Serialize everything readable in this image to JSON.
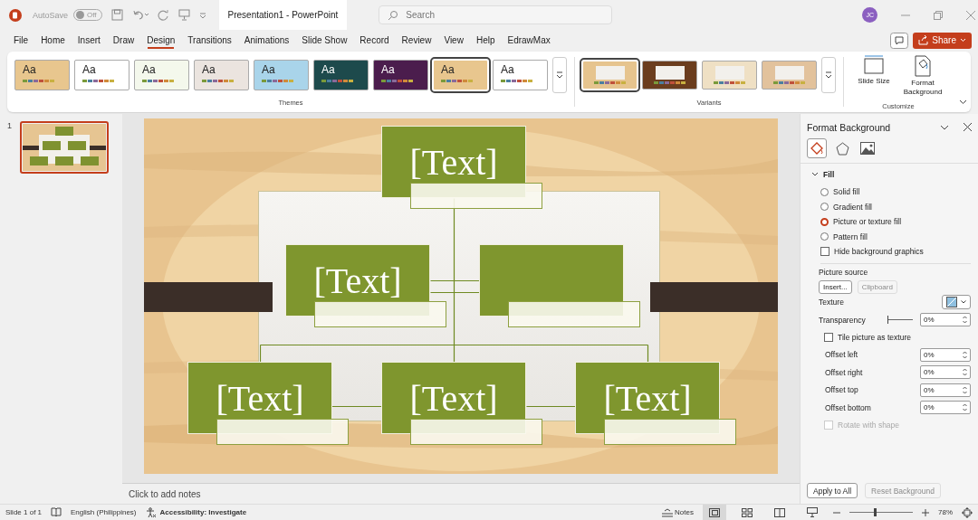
{
  "title_bar": {
    "autosave_label": "AutoSave",
    "autosave": {
      "on": false,
      "label": "Off"
    },
    "title": "Presentation1  -  PowerPoint",
    "search": {
      "placeholder": "Search"
    },
    "avatar": "JC"
  },
  "menu": {
    "tabs": [
      {
        "label": "File",
        "selected": false
      },
      {
        "label": "Home",
        "selected": false
      },
      {
        "label": "Insert",
        "selected": false
      },
      {
        "label": "Draw",
        "selected": false
      },
      {
        "label": "Design",
        "selected": true
      },
      {
        "label": "Transitions",
        "selected": false
      },
      {
        "label": "Animations",
        "selected": false
      },
      {
        "label": "Slide Show",
        "selected": false
      },
      {
        "label": "Record",
        "selected": false
      },
      {
        "label": "Review",
        "selected": false
      },
      {
        "label": "View",
        "selected": false
      },
      {
        "label": "Help",
        "selected": false
      },
      {
        "label": "EdrawMax",
        "selected": false
      }
    ],
    "share": "Share"
  },
  "ribbon": {
    "themes": [
      {
        "label": "Aa",
        "color": "#e8c68e",
        "selected": false
      },
      {
        "label": "Aa",
        "color": "#ffffff",
        "selected": false
      },
      {
        "label": "Aa",
        "color": "#f4f8ec",
        "selected": false
      },
      {
        "label": "Aa",
        "color": "#ebe4df",
        "selected": false
      },
      {
        "label": "Aa",
        "color": "#a9d4ea",
        "selected": false
      },
      {
        "label": "Aa",
        "color": "#1d4a4c",
        "selected": false
      },
      {
        "label": "Aa",
        "color": "#4b1d4d",
        "selected": false
      },
      {
        "label": "Aa",
        "color": "#e8c68e",
        "selected": true
      },
      {
        "label": "Aa",
        "color": "#ffffff",
        "selected": false
      }
    ],
    "themes_label": "Themes",
    "variants": [
      {
        "color": "#e6c48e",
        "selected": true
      },
      {
        "color": "#6b3d1e",
        "selected": false
      },
      {
        "color": "#efe0c4",
        "selected": false
      },
      {
        "color": "#e2c29c",
        "selected": false
      }
    ],
    "variants_label": "Variants",
    "customize": [
      {
        "label": "Slide Size",
        "kind": "size"
      },
      {
        "label": "Format Background",
        "kind": "background"
      }
    ],
    "customize_label": "Customize"
  },
  "thumbnails": [
    {
      "number": "1",
      "selected": true
    }
  ],
  "slide": {
    "nodes": [
      {
        "kind": "text",
        "text": "[Text]"
      },
      {
        "kind": "text",
        "text": "[Text]"
      },
      {
        "kind": "blank"
      },
      {
        "kind": "text",
        "text": "[Text]"
      },
      {
        "kind": "text",
        "text": "[Text]"
      },
      {
        "kind": "text",
        "text": "[Text]"
      }
    ]
  },
  "notes": {
    "placeholder": "Click to add notes"
  },
  "panel": {
    "title": "Format Background",
    "tabs": [
      {
        "kind": "fill",
        "selected": true
      },
      {
        "kind": "effects",
        "selected": false
      },
      {
        "kind": "picture",
        "selected": false
      }
    ],
    "section": {
      "label": "Fill",
      "expanded": true
    },
    "fill_options": [
      {
        "label": "Solid fill",
        "selected": false
      },
      {
        "label": "Gradient fill",
        "selected": false
      },
      {
        "label": "Picture or texture fill",
        "selected": true
      },
      {
        "label": "Pattern fill",
        "selected": false
      }
    ],
    "hide_graphics": {
      "label": "Hide background graphics",
      "checked": false
    },
    "picture_source_label": "Picture source",
    "insert": "Insert...",
    "clipboard": {
      "label": "Clipboard",
      "disabled": true
    },
    "texture_label": "Texture",
    "transparency": {
      "label": "Transparency",
      "level": 0,
      "value": "0%"
    },
    "tile": {
      "label": "Tile picture as texture",
      "checked": false
    },
    "offsets": [
      {
        "label": "Offset left",
        "value": "0%"
      },
      {
        "label": "Offset right",
        "value": "0%"
      },
      {
        "label": "Offset top",
        "value": "0%"
      },
      {
        "label": "Offset bottom",
        "value": "0%"
      }
    ],
    "rotate": {
      "label": "Rotate with shape",
      "checked": false,
      "disabled": true
    },
    "apply": "Apply to All",
    "reset": {
      "label": "Reset Background",
      "disabled": true
    }
  },
  "status_bar": {
    "slide": "Slide 1 of 1",
    "language": "English (Philippines)",
    "accessibility": "Accessibility: Investigate",
    "notes": "Notes",
    "views": [
      {
        "kind": "normal",
        "selected": true
      },
      {
        "kind": "sorter",
        "selected": false
      },
      {
        "kind": "reading",
        "selected": false
      },
      {
        "kind": "slideshow",
        "selected": false
      }
    ],
    "zoom": {
      "level": 0.38,
      "value": "78%"
    }
  }
}
